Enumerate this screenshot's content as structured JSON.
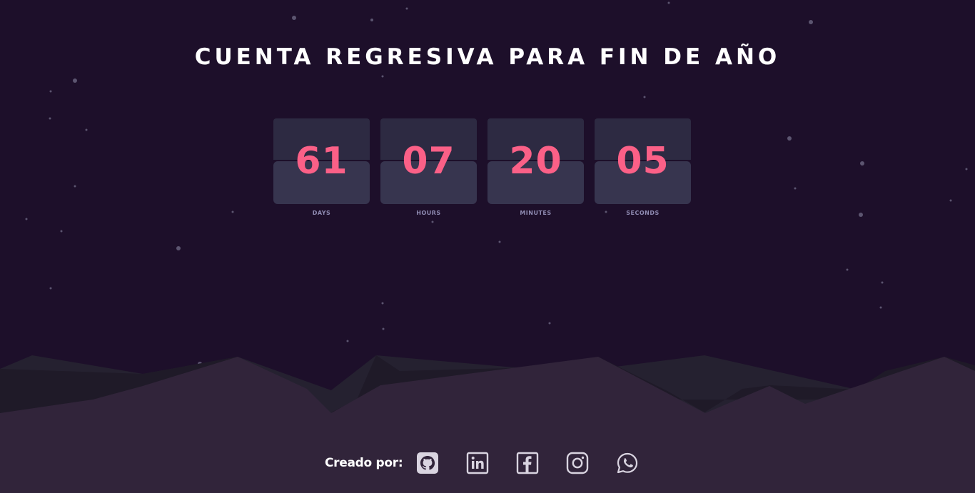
{
  "title": "CUENTA REGRESIVA PARA FIN DE AÑO",
  "countdown": [
    {
      "value": "61",
      "label": "DAYS"
    },
    {
      "value": "07",
      "label": "HOURS"
    },
    {
      "value": "20",
      "label": "MINUTES"
    },
    {
      "value": "05",
      "label": "SECONDS"
    }
  ],
  "footer": {
    "label": "Creado por:",
    "social_icons": [
      "github-icon",
      "linkedin-icon",
      "facebook-icon",
      "instagram-icon",
      "whatsapp-icon"
    ]
  },
  "colors": {
    "background": "#1d0f2a",
    "accent_number": "#fb6087",
    "card_top": "#2d2a42",
    "card_bottom": "#37354f",
    "label": "#8f8bb2",
    "hills": "#31243a"
  }
}
